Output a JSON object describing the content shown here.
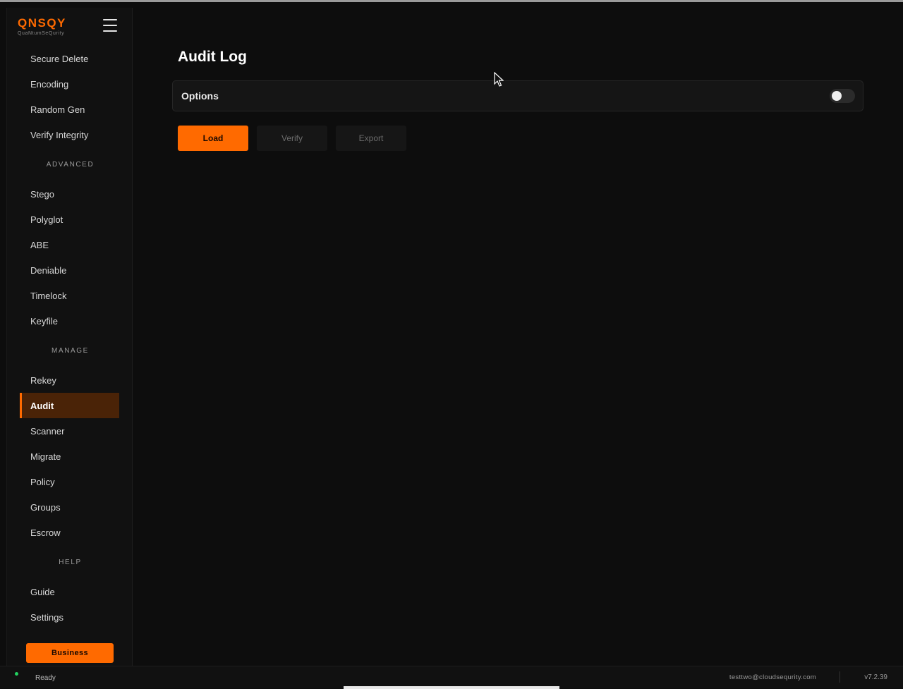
{
  "app": {
    "logo_mark": "QNSQY",
    "logo_sub": "QuaNtumSeQurity"
  },
  "sidebar": {
    "items": [
      {
        "type": "item",
        "label": "Secure Delete"
      },
      {
        "type": "item",
        "label": "Encoding"
      },
      {
        "type": "item",
        "label": "Random Gen"
      },
      {
        "type": "item",
        "label": "Verify Integrity"
      },
      {
        "type": "section",
        "label": "ADVANCED"
      },
      {
        "type": "item",
        "label": "Stego"
      },
      {
        "type": "item",
        "label": "Polyglot"
      },
      {
        "type": "item",
        "label": "ABE"
      },
      {
        "type": "item",
        "label": "Deniable"
      },
      {
        "type": "item",
        "label": "Timelock"
      },
      {
        "type": "item",
        "label": "Keyfile"
      },
      {
        "type": "section",
        "label": "MANAGE"
      },
      {
        "type": "item",
        "label": "Rekey"
      },
      {
        "type": "item",
        "label": "Audit",
        "active": true
      },
      {
        "type": "item",
        "label": "Scanner"
      },
      {
        "type": "item",
        "label": "Migrate"
      },
      {
        "type": "item",
        "label": "Policy"
      },
      {
        "type": "item",
        "label": "Groups"
      },
      {
        "type": "item",
        "label": "Escrow"
      },
      {
        "type": "section",
        "label": "HELP"
      },
      {
        "type": "item",
        "label": "Guide"
      },
      {
        "type": "item",
        "label": "Settings"
      }
    ],
    "business_label": "Business"
  },
  "main": {
    "title": "Audit Log",
    "options_label": "Options",
    "options_enabled": false,
    "buttons": {
      "load": "Load",
      "verify": "Verify",
      "export": "Export"
    }
  },
  "status": {
    "text": "Ready",
    "email": "testtwo@cloudsequrity.com",
    "version": "v7.2.39"
  },
  "colors": {
    "accent": "#ff6a00",
    "active_bg": "#4a2307",
    "status_ok": "#23d160"
  }
}
